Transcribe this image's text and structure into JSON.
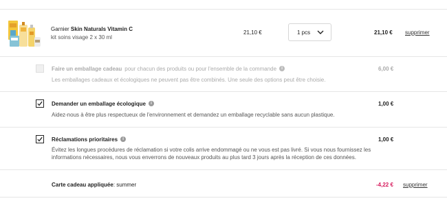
{
  "product": {
    "brand": "Garnier",
    "name": "Skin Naturals Vitamin C",
    "subtitle": "kit soins visage 2 x 30 ml",
    "unit_price": "21,10 €",
    "quantity_label": "1 pcs",
    "line_total": "21,10 €",
    "remove_label": "supprimer"
  },
  "options": [
    {
      "title": "Faire un emballage cadeau",
      "extra": "pour chacun des produits ou pour l'ensemble de la commande",
      "description": [
        "Les emballages cadeaux et écologiques ne peuvent pas être combinés. Une seule des options peut être choisie."
      ],
      "price": "6,00 €",
      "checked": false,
      "disabled": true
    },
    {
      "title": "Demander un emballage écologique",
      "extra": "",
      "description": [
        "Aidez-nous à être plus respectueux de l'environnement et demandez un emballage recyclable sans aucun plastique."
      ],
      "price": "1,00 €",
      "checked": true,
      "disabled": false
    },
    {
      "title": "Réclamations prioritaires",
      "extra": "",
      "description": [
        "Évitez les longues procédures de réclamation si votre colis arrive endommagé ou ne vous est pas livré. Si vous nous fournissez les",
        "informations nécessaires, nous vous enverrons de nouveaux produits au plus tard 3 jours après la réception de ces données."
      ],
      "price": "1,00 €",
      "checked": true,
      "disabled": false
    }
  ],
  "gift_card": {
    "label": "Carte cadeau appliquée",
    "separator": ":",
    "code": "summer",
    "amount": "-4,22 €",
    "remove_label": "supprimer"
  },
  "colors": {
    "discount": "#d6195b",
    "divider": "#e6e6e6"
  },
  "icons": [
    "product-thumbnail",
    "chevron-down-icon",
    "checkmark-icon",
    "info-icon"
  ]
}
